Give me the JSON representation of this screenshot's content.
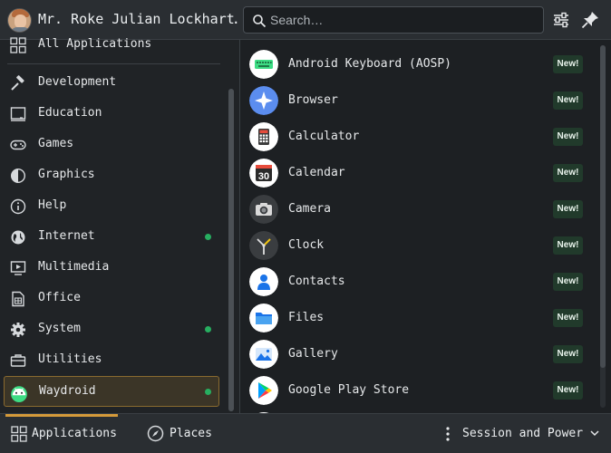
{
  "header": {
    "username": "Mr. Roke Julian Lockhart…",
    "search_placeholder": "Search…"
  },
  "sidebar": {
    "items": [
      {
        "label": "All Applications",
        "icon": "grid-icon",
        "dot": false
      },
      {
        "label": "Development",
        "icon": "hammer-icon",
        "dot": false
      },
      {
        "label": "Education",
        "icon": "board-icon",
        "dot": false
      },
      {
        "label": "Games",
        "icon": "gamepad-icon",
        "dot": false
      },
      {
        "label": "Graphics",
        "icon": "palette-icon",
        "dot": false
      },
      {
        "label": "Help",
        "icon": "info-icon",
        "dot": false
      },
      {
        "label": "Internet",
        "icon": "globe-icon",
        "dot": true
      },
      {
        "label": "Multimedia",
        "icon": "monitor-play-icon",
        "dot": false
      },
      {
        "label": "Office",
        "icon": "document-icon",
        "dot": false
      },
      {
        "label": "System",
        "icon": "gear-icon",
        "dot": true
      },
      {
        "label": "Utilities",
        "icon": "toolbox-icon",
        "dot": false
      },
      {
        "label": "Waydroid",
        "icon": "android-icon",
        "dot": true,
        "selected": true
      }
    ]
  },
  "apps": {
    "badge_label": "New!",
    "items": [
      {
        "name": "Android Keyboard (AOSP)",
        "icon": "keyboard-icon"
      },
      {
        "name": "Browser",
        "icon": "browser-icon"
      },
      {
        "name": "Calculator",
        "icon": "calculator-icon"
      },
      {
        "name": "Calendar",
        "icon": "calendar-icon",
        "icon_text": "30"
      },
      {
        "name": "Camera",
        "icon": "camera-icon"
      },
      {
        "name": "Clock",
        "icon": "clock-icon"
      },
      {
        "name": "Contacts",
        "icon": "contacts-icon"
      },
      {
        "name": "Files",
        "icon": "folder-icon"
      },
      {
        "name": "Gallery",
        "icon": "gallery-icon"
      },
      {
        "name": "Google Play Store",
        "icon": "play-store-icon"
      }
    ]
  },
  "footer": {
    "tab_applications": "Applications",
    "tab_places": "Places",
    "session_label": "Session and Power"
  },
  "colors": {
    "accent": "#d59a3a",
    "status_dot": "#27ae60",
    "badge_bg": "#213a2b"
  }
}
